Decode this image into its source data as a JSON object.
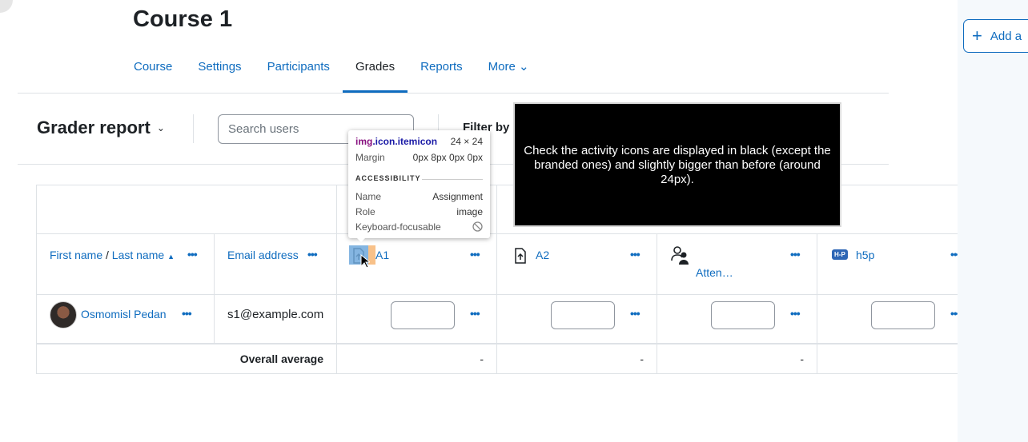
{
  "course": {
    "title": "Course 1"
  },
  "nav": {
    "items": [
      {
        "label": "Course"
      },
      {
        "label": "Settings"
      },
      {
        "label": "Participants"
      },
      {
        "label": "Grades"
      },
      {
        "label": "Reports"
      },
      {
        "label": "More ⌄"
      }
    ],
    "active": "Grades"
  },
  "sidebar": {
    "add_label": "Add a"
  },
  "report": {
    "title": "Grader report",
    "search_placeholder": "Search users",
    "filter_label": "Filter by"
  },
  "table": {
    "col_first_name": "First name",
    "col_separator": "/",
    "col_last_name": "Last name",
    "col_email": "Email address",
    "activities": [
      {
        "label": "A1",
        "icon": "assignment-icon"
      },
      {
        "label": "A2",
        "icon": "assignment-icon"
      },
      {
        "label": "Atten…",
        "icon": "attendance-icon"
      },
      {
        "label": "h5p",
        "icon": "h5p-icon",
        "badge": "H-P"
      }
    ],
    "row": {
      "name": "Osmomisl Pedan",
      "email": "s1@example.com"
    },
    "overall_label": "Overall average",
    "averages": [
      "-",
      "-",
      "-",
      ""
    ],
    "menu_glyph": "•••"
  },
  "devtools_tooltip": {
    "selector_tag": "img",
    "selector_classes": ".icon.itemicon",
    "size": "24 × 24",
    "margin_label": "Margin",
    "margin_value": "0px 8px 0px 0px",
    "section": "ACCESSIBILITY",
    "name_label": "Name",
    "name_value": "Assignment",
    "role_label": "Role",
    "role_value": "image",
    "keyboard_label": "Keyboard-focusable"
  },
  "instruction": {
    "text": "Check the activity icons are displayed in black (except the branded ones) and slightly bigger than before (around 24px)."
  },
  "colors": {
    "accent": "#0f6cbf",
    "border": "#dee2e6",
    "overlay": "#000000"
  }
}
